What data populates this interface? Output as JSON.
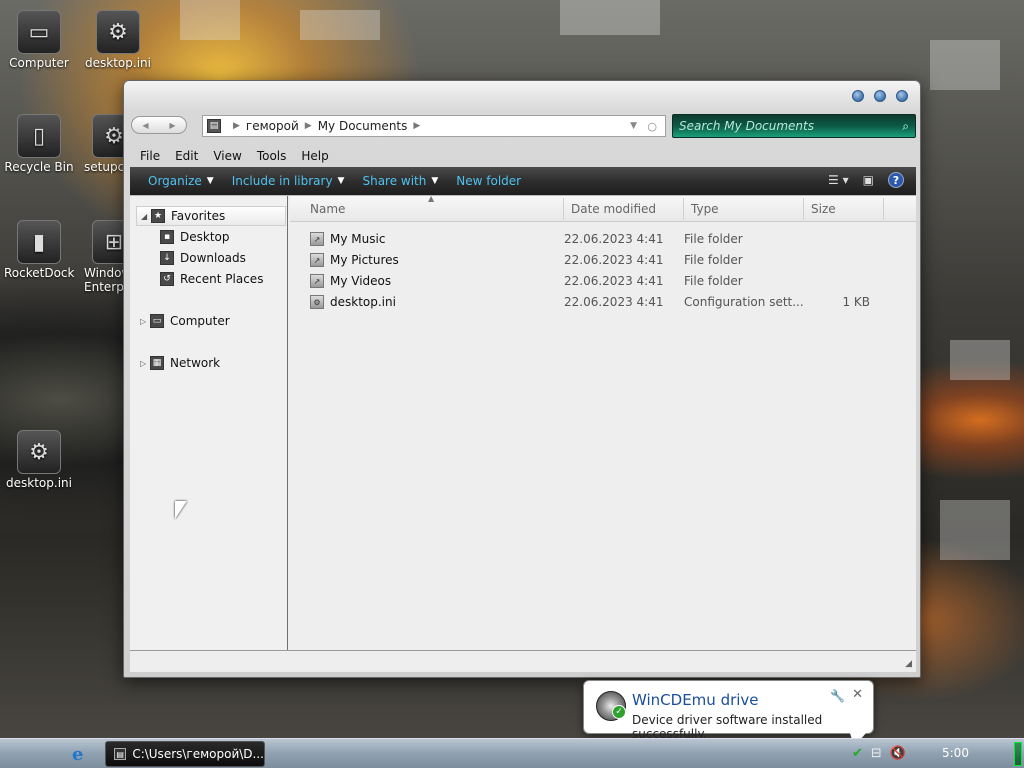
{
  "desktop": {
    "icons": [
      {
        "label": "Computer"
      },
      {
        "label": "desktop.ini"
      },
      {
        "label": "Recycle Bin"
      },
      {
        "label": "setupce"
      },
      {
        "label": "RocketDock"
      },
      {
        "label": "Window Enterpr"
      },
      {
        "label": "desktop.ini"
      }
    ]
  },
  "window": {
    "address": {
      "crumbs": [
        "геморой",
        "My Documents"
      ]
    },
    "search": {
      "placeholder": "Search My Documents"
    },
    "menu": [
      "File",
      "Edit",
      "View",
      "Tools",
      "Help"
    ],
    "commands": {
      "organize": "Organize",
      "include_in_library": "Include in library",
      "share_with": "Share with",
      "new_folder": "New folder"
    },
    "nav": {
      "favorites": "Favorites",
      "desktop": "Desktop",
      "downloads": "Downloads",
      "recent_places": "Recent Places",
      "computer": "Computer",
      "network": "Network"
    },
    "columns": {
      "name": "Name",
      "date": "Date modified",
      "type": "Type",
      "size": "Size"
    },
    "files": [
      {
        "name": "My Music",
        "date": "22.06.2023 4:41",
        "type": "File folder",
        "size": ""
      },
      {
        "name": "My Pictures",
        "date": "22.06.2023 4:41",
        "type": "File folder",
        "size": ""
      },
      {
        "name": "My Videos",
        "date": "22.06.2023 4:41",
        "type": "File folder",
        "size": ""
      },
      {
        "name": "desktop.ini",
        "date": "22.06.2023 4:41",
        "type": "Configuration sett...",
        "size": "1 KB"
      }
    ]
  },
  "balloon": {
    "title": "WinCDEmu drive",
    "message": "Device driver software installed successfully."
  },
  "taskbar": {
    "task_label": "C:\\Users\\геморой\\D...",
    "clock": "5:00"
  }
}
